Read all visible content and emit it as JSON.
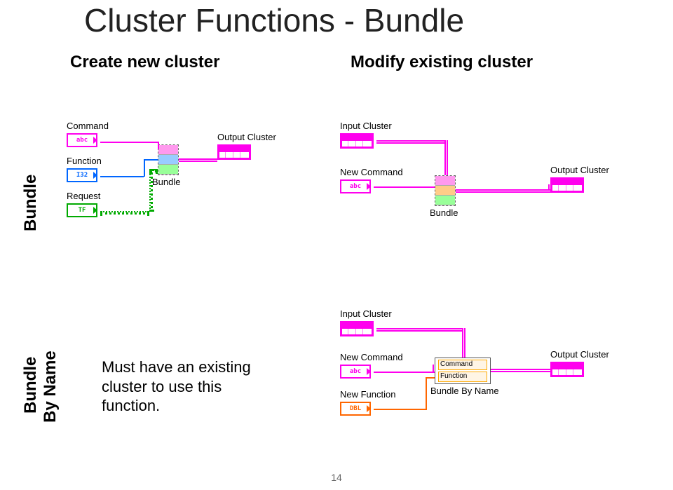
{
  "page": {
    "title": "Cluster Functions - Bundle",
    "number": "14"
  },
  "subheads": {
    "create": "Create new cluster",
    "modify": "Modify existing cluster"
  },
  "side": {
    "bundle": "Bundle",
    "byname_l1": "Bundle",
    "byname_l2": "By Name"
  },
  "note": {
    "line": "Must have an existing cluster to use this function."
  },
  "labels": {
    "command": "Command",
    "function": "Function",
    "request": "Request",
    "output_cluster": "Output Cluster",
    "bundle": "Bundle",
    "input_cluster": "Input Cluster",
    "new_command": "New Command",
    "new_function": "New Function",
    "bundle_by_name": "Bundle By Name",
    "abc": "abc",
    "i32": "I32",
    "tf": "TF",
    "dbl": "DBL"
  },
  "bbn": {
    "row1": "Command",
    "row2": "Function"
  }
}
